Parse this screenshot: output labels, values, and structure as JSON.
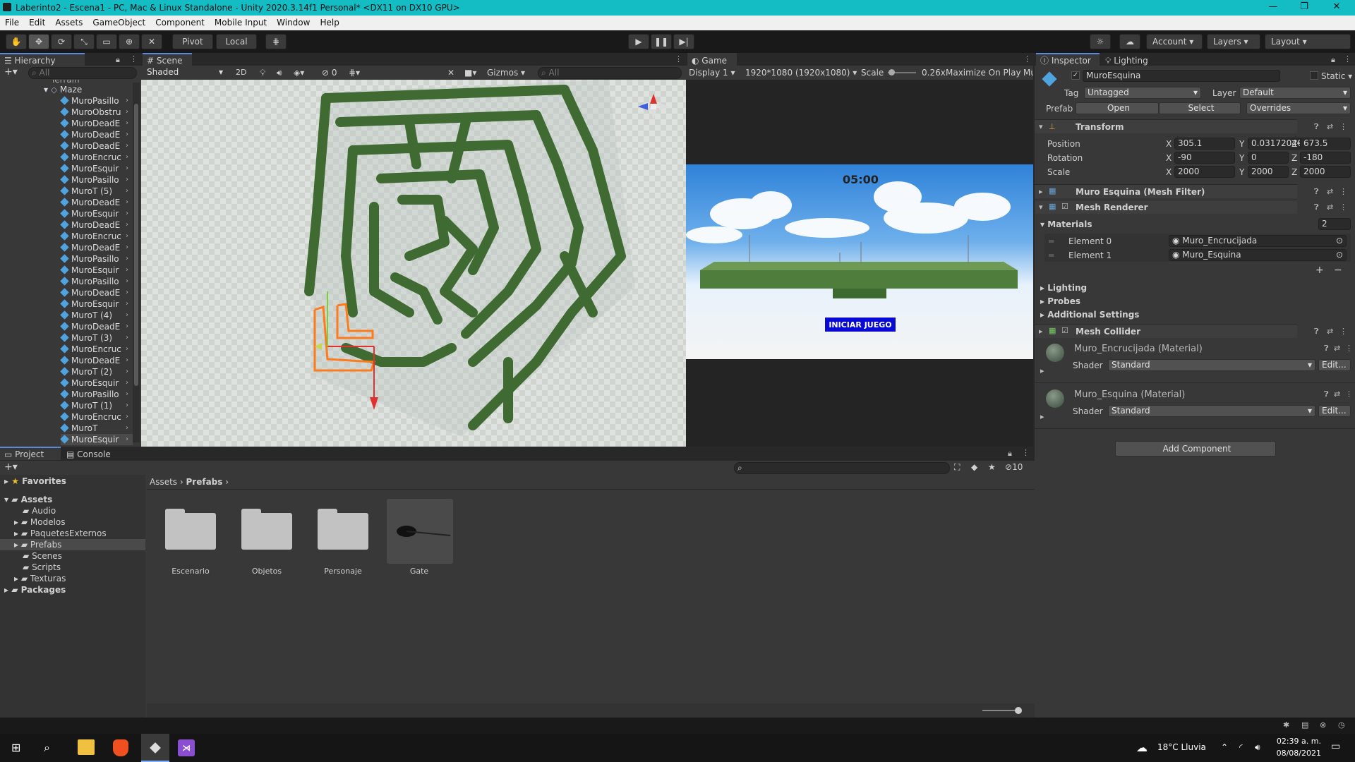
{
  "window": {
    "title": "Laberinto2 - Escena1 - PC, Mac & Linux Standalone - Unity 2020.3.14f1 Personal* <DX11 on DX10 GPU>",
    "minimize": "—",
    "maximize": "❐",
    "close": "✕"
  },
  "menu": [
    "File",
    "Edit",
    "Assets",
    "GameObject",
    "Component",
    "Mobile Input",
    "Window",
    "Help"
  ],
  "toolbar": {
    "pivot": "Pivot",
    "local": "Local",
    "account": "Account",
    "layers": "Layers",
    "layout": "Layout"
  },
  "hierarchy": {
    "tab": "Hierarchy",
    "search_placeholder": "All",
    "cut_item": "Terrain",
    "parent": "Maze",
    "items": [
      "MuroPasillo",
      "MuroObstru",
      "MuroDeadE",
      "MuroDeadE",
      "MuroDeadE",
      "MuroEncruc",
      "MuroEsquir",
      "MuroPasillo",
      "MuroT (5)",
      "MuroDeadE",
      "MuroEsquir",
      "MuroDeadE",
      "MuroEncruc",
      "MuroDeadE",
      "MuroPasillo",
      "MuroEsquir",
      "MuroPasillo",
      "MuroDeadE",
      "MuroEsquir",
      "MuroT (4)",
      "MuroDeadE",
      "MuroT (3)",
      "MuroEncruc",
      "MuroDeadE",
      "MuroT (2)",
      "MuroEsquir",
      "MuroPasillo",
      "MuroT (1)",
      "MuroEncruc",
      "MuroT",
      "MuroEsquir"
    ]
  },
  "scene": {
    "tab": "Scene",
    "shading": "Shaded",
    "mode2d": "2D",
    "hidden_count": "0",
    "gizmos": "Gizmos",
    "search_placeholder": "All"
  },
  "game": {
    "tab": "Game",
    "display": "Display 1",
    "resolution": "1920*1080 (1920x1080)",
    "scale_label": "Scale",
    "scale_value": "0.26x",
    "maximize": "Maximize On Play",
    "mute": "Mu",
    "timer": "05:00",
    "start_button": "INICIAR  JUEGO"
  },
  "inspector": {
    "tab": "Inspector",
    "lighting_tab": "Lighting",
    "object_name": "MuroEsquina",
    "static_label": "Static",
    "tag_label": "Tag",
    "tag_value": "Untagged",
    "layer_label": "Layer",
    "layer_value": "Default",
    "prefab_label": "Prefab",
    "open": "Open",
    "select": "Select",
    "overrides": "Overrides",
    "transform": {
      "title": "Transform",
      "position_label": "Position",
      "rotation_label": "Rotation",
      "scale_label": "Scale",
      "position": {
        "x": "305.1",
        "y": "0.0317204€",
        "z": "673.5"
      },
      "rotation": {
        "x": "-90",
        "y": "0",
        "z": "-180"
      },
      "scale": {
        "x": "2000",
        "y": "2000",
        "z": "2000"
      }
    },
    "mesh_filter": "Muro Esquina (Mesh Filter)",
    "mesh_renderer": {
      "title": "Mesh Renderer",
      "materials_label": "Materials",
      "materials_count": "2",
      "elements": [
        {
          "label": "Element 0",
          "value": "Muro_Encrucijada"
        },
        {
          "label": "Element 1",
          "value": "Muro_Esquina"
        }
      ],
      "lighting": "Lighting",
      "probes": "Probes",
      "additional": "Additional Settings"
    },
    "mesh_collider": "Mesh Collider",
    "materials": [
      {
        "name": "Muro_Encrucijada (Material)",
        "shader_label": "Shader",
        "shader": "Standard",
        "edit": "Edit..."
      },
      {
        "name": "Muro_Esquina (Material)",
        "shader_label": "Shader",
        "shader": "Standard",
        "edit": "Edit..."
      }
    ],
    "add_component": "Add Component"
  },
  "project": {
    "tab": "Project",
    "console_tab": "Console",
    "favorites": "Favorites",
    "assets": "Assets",
    "tree": [
      "Audio",
      "Modelos",
      "PaquetesExternos",
      "Prefabs",
      "Scenes",
      "Scripts",
      "Texturas"
    ],
    "packages": "Packages",
    "breadcrumb": [
      "Assets",
      "Prefabs"
    ],
    "hidden_count": "10",
    "items": [
      "Escenario",
      "Objetos",
      "Personaje",
      "Gate"
    ]
  },
  "taskbar": {
    "weather": "18°C  Lluvia",
    "time": "02:39 a. m.",
    "date": "08/08/2021"
  },
  "colors": {
    "title_bar": "#13bdc3",
    "accent_blue": "#5b8ad9",
    "selection": "#ff6a00",
    "start_button": "#0a0ad6"
  }
}
